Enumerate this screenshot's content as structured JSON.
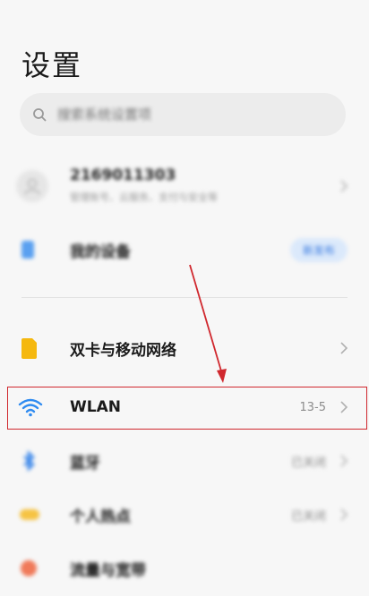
{
  "header": {
    "title": "设置"
  },
  "search": {
    "placeholder": "搜索系统设置项"
  },
  "account": {
    "name": "2169011303",
    "subtitle": "管理账号、云服务、支付与安全等"
  },
  "my_device": {
    "label": "我的设备",
    "badge": "新发布"
  },
  "settings_items": [
    {
      "label": "双卡与移动网络",
      "value": ""
    },
    {
      "label": "WLAN",
      "value": "13-5"
    },
    {
      "label": "蓝牙",
      "value": "已关闭"
    },
    {
      "label": "个人热点",
      "value": "已关闭"
    },
    {
      "label": "流量与宽带",
      "value": ""
    }
  ],
  "colors": {
    "annotation_red": "#d0282e",
    "wifi_blue": "#2f8bf0",
    "sim_yellow": "#f5b80f",
    "bluetooth_blue": "#2a7de8",
    "hotspot_yellow": "#f6c343",
    "accent_blue": "#3a7be0"
  },
  "icons": [
    "search-icon",
    "avatar-icon",
    "phone-device-icon",
    "sim-card-icon",
    "wifi-icon",
    "bluetooth-icon",
    "hotspot-icon",
    "chevron-right-icon"
  ]
}
